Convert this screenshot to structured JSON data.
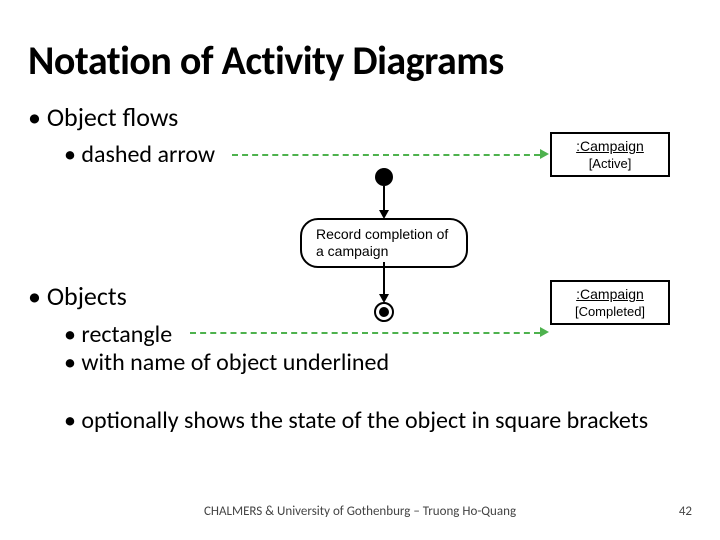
{
  "title": "Notation of Activity Diagrams",
  "bullets": {
    "objectFlows": "Object flows",
    "dashedArrow": "dashed arrow",
    "objects": "Objects",
    "rectangle": "rectangle",
    "nameUnderlined": "with name of object underlined",
    "stateBrackets": "optionally shows the state of the object in square brackets"
  },
  "diagram": {
    "activity": "Record completion of a campaign",
    "obj1": {
      "name": ":Campaign",
      "state": "[Active]"
    },
    "obj2": {
      "name": ":Campaign",
      "state": "[Completed]"
    }
  },
  "footer": "CHALMERS & University of Gothenburg – Truong Ho-Quang",
  "page": "42"
}
